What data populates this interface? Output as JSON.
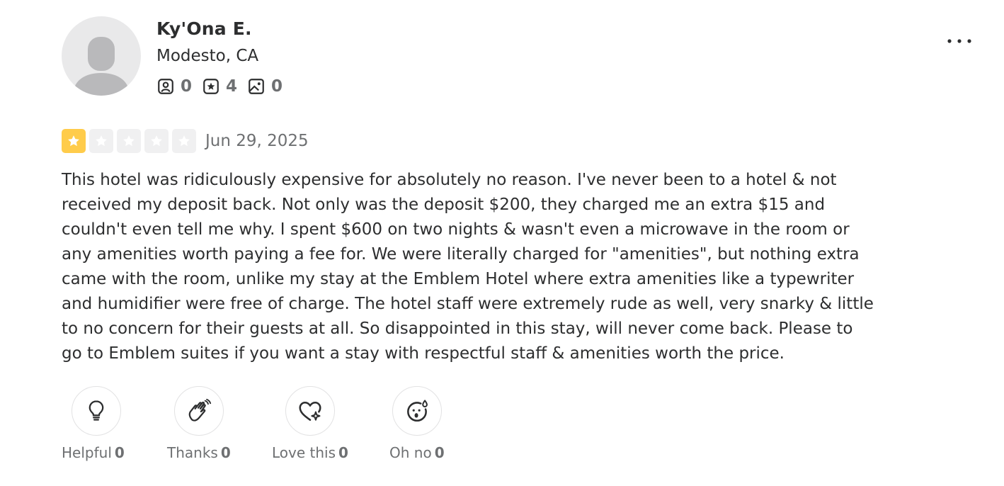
{
  "user": {
    "name": "Ky'Ona E.",
    "location": "Modesto, CA",
    "stats": {
      "friends": "0",
      "reviews": "4",
      "photos": "0"
    }
  },
  "review": {
    "rating": 1,
    "max_rating": 5,
    "date": "Jun 29, 2025",
    "text": "This hotel was ridiculously expensive for absolutely no reason. I've never been to a hotel & not received my deposit back. Not only was the deposit $200, they charged me an extra $15 and couldn't even tell me why. I spent $600 on two nights & wasn't even a microwave in the room or any amenities worth paying a fee for. We were literally charged for \"amenities\", but nothing extra came with the room, unlike my stay at the Emblem Hotel where extra amenities like a typewriter and humidifier were free of charge. The hotel staff were extremely rude as well, very snarky & little to no concern for their guests at all. So disappointed in this stay, will never come back. Please to go to Emblem suites if you want a stay with respectful staff & amenities worth the price."
  },
  "reactions": [
    {
      "label": "Helpful",
      "count": "0",
      "icon": "lightbulb-icon"
    },
    {
      "label": "Thanks",
      "count": "0",
      "icon": "waving-hands-icon"
    },
    {
      "label": "Love this",
      "count": "0",
      "icon": "heart-sparkle-icon"
    },
    {
      "label": "Oh no",
      "count": "0",
      "icon": "surprised-face-icon"
    }
  ],
  "colors": {
    "star_filled": "#ffcc4b",
    "star_empty": "#f0f0f1",
    "text": "#2d2e2f",
    "muted": "#6e7072"
  }
}
